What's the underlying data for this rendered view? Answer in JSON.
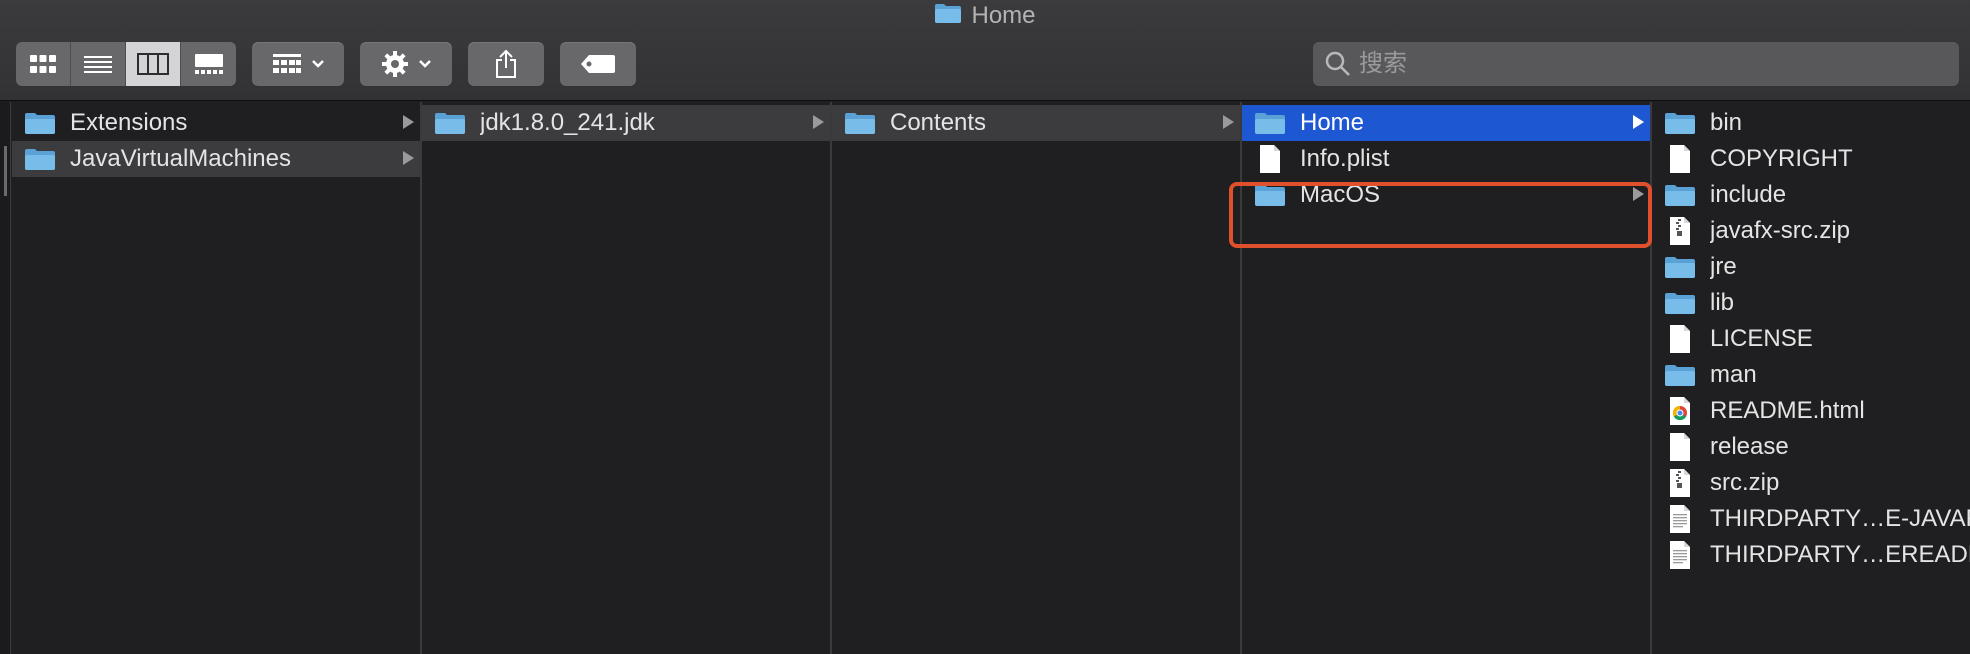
{
  "window": {
    "title": "Home",
    "title_icon": "folder-icon"
  },
  "toolbar": {
    "view_buttons": [
      {
        "name": "icon-view-button",
        "icon": "grid-icon"
      },
      {
        "name": "list-view-button",
        "icon": "list-icon"
      },
      {
        "name": "column-view-button",
        "icon": "columns-icon",
        "active": true
      },
      {
        "name": "gallery-view-button",
        "icon": "gallery-icon"
      }
    ],
    "group_icon": "group-by-icon",
    "action_icon": "gear-icon",
    "share_icon": "share-icon",
    "tag_icon": "tag-icon",
    "search": {
      "placeholder": "搜索",
      "value": ""
    }
  },
  "columns": [
    {
      "items": [
        {
          "label": "Extensions",
          "type": "folder",
          "arrow": true
        },
        {
          "label": "JavaVirtualMachines",
          "type": "folder",
          "arrow": true,
          "selected": "inactive"
        }
      ]
    },
    {
      "items": [
        {
          "label": "jdk1.8.0_241.jdk",
          "type": "folder",
          "arrow": true,
          "selected": "inactive"
        }
      ]
    },
    {
      "items": [
        {
          "label": "Contents",
          "type": "folder",
          "arrow": true,
          "selected": "inactive"
        }
      ]
    },
    {
      "items": [
        {
          "label": "Home",
          "type": "folder",
          "arrow": true,
          "selected": "active"
        },
        {
          "label": "Info.plist",
          "type": "file"
        },
        {
          "label": "MacOS",
          "type": "folder",
          "arrow": true
        }
      ]
    },
    {
      "items": [
        {
          "label": "bin",
          "type": "folder"
        },
        {
          "label": "COPYRIGHT",
          "type": "file"
        },
        {
          "label": "include",
          "type": "folder"
        },
        {
          "label": "javafx-src.zip",
          "type": "zip"
        },
        {
          "label": "jre",
          "type": "folder"
        },
        {
          "label": "lib",
          "type": "folder"
        },
        {
          "label": "LICENSE",
          "type": "file"
        },
        {
          "label": "man",
          "type": "folder"
        },
        {
          "label": "README.html",
          "type": "html"
        },
        {
          "label": "release",
          "type": "file"
        },
        {
          "label": "src.zip",
          "type": "zip"
        },
        {
          "label": "THIRDPARTY…E-JAVAFX.txt",
          "type": "text"
        },
        {
          "label": "THIRDPARTY…EREADME.txt",
          "type": "text"
        }
      ]
    }
  ],
  "colors": {
    "selection": "#1d57d1",
    "highlight_box": "#e0502c",
    "folder": "#6fb3e3"
  }
}
